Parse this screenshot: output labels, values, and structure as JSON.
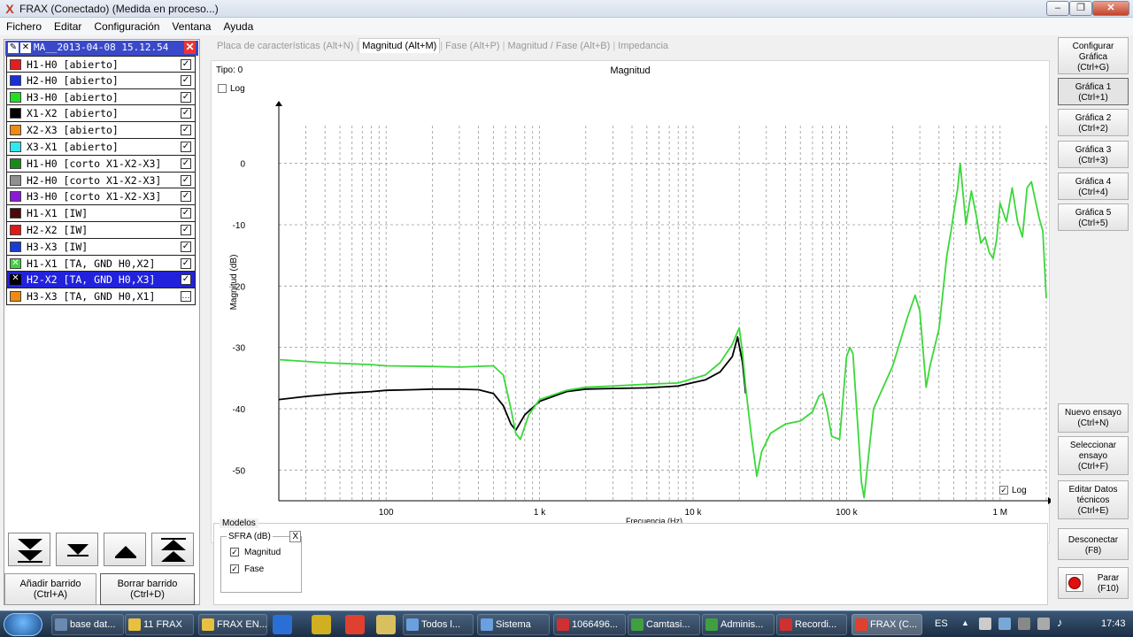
{
  "window": {
    "title": "FRAX (Conectado) (Medida en proceso...)",
    "app_icon": "X",
    "min_label": "–",
    "max_label": "❐",
    "close_label": "✕"
  },
  "menu": [
    "Fichero",
    "Editar",
    "Configuración",
    "Ventana",
    "Ayuda"
  ],
  "test": {
    "name": "MA__2013-04-08 15.12.54",
    "close_label": "✕"
  },
  "measurements": [
    {
      "label": "H1-H0 [abierto]",
      "color": "#e02020",
      "checked": true
    },
    {
      "label": "H2-H0 [abierto]",
      "color": "#1a2fd8",
      "checked": true
    },
    {
      "label": "H3-H0 [abierto]",
      "color": "#22e022",
      "checked": true
    },
    {
      "label": "X1-X2 [abierto]",
      "color": "#000000",
      "checked": true
    },
    {
      "label": "X2-X3 [abierto]",
      "color": "#f08a10",
      "checked": true
    },
    {
      "label": "X3-X1 [abierto]",
      "color": "#30e8f0",
      "checked": true
    },
    {
      "label": "H1-H0 [corto X1-X2-X3]",
      "color": "#1a8a1a",
      "checked": true
    },
    {
      "label": "H2-H0 [corto X1-X2-X3]",
      "color": "#909090",
      "checked": true
    },
    {
      "label": "H3-H0 [corto X1-X2-X3]",
      "color": "#8a1ad8",
      "checked": true
    },
    {
      "label": "H1-X1 [IW]",
      "color": "#4a0a0a",
      "checked": true
    },
    {
      "label": "H2-X2 [IW]",
      "color": "#e01818",
      "checked": true
    },
    {
      "label": "H3-X3 [IW]",
      "color": "#1a3ad8",
      "checked": true
    },
    {
      "label": "H1-X1 [TA, GND H0,X2]",
      "color": "#40d040",
      "checked": true
    },
    {
      "label": "H2-X2 [TA, GND H0,X3]",
      "color": "#000000",
      "checked": true,
      "selected": true
    },
    {
      "label": "H3-X3 [TA, GND H0,X1]",
      "color": "#f08a10",
      "checked": false
    }
  ],
  "left_buttons": {
    "add": "Añadir barrido\n(Ctrl+A)",
    "delete": "Borrar barrido\n(Ctrl+D)"
  },
  "tabs": [
    {
      "label": "Placa de características (Alt+N)",
      "active": false
    },
    {
      "label": "Magnitud (Alt+M)",
      "active": true
    },
    {
      "label": "Fase (Alt+P)",
      "active": false
    },
    {
      "label": "Magnitud / Fase (Alt+B)",
      "active": false
    },
    {
      "label": "Impedancia",
      "active": false
    }
  ],
  "chart_header": {
    "tipo": "Tipo: 0",
    "log_y_label": "Log",
    "log_x_label": "Log"
  },
  "chart_data": {
    "type": "line",
    "title": "Magnitud",
    "xlabel": "Frecuencia (Hz)",
    "ylabel": "Magnitud (dB)",
    "x_scale": "log",
    "xlim": [
      20,
      2000000
    ],
    "ylim": [
      -55,
      5
    ],
    "x_ticks": [
      {
        "value": 100,
        "label": "100"
      },
      {
        "value": 1000,
        "label": "1 k"
      },
      {
        "value": 10000,
        "label": "10 k"
      },
      {
        "value": 100000,
        "label": "100 k"
      },
      {
        "value": 1000000,
        "label": "1 M"
      }
    ],
    "y_ticks": [
      0,
      -10,
      -20,
      -30,
      -40,
      -50
    ],
    "grid": true,
    "series": [
      {
        "color": "#000000",
        "x": [
          20,
          30,
          50,
          80,
          100,
          150,
          200,
          300,
          400,
          500,
          580,
          650,
          700,
          800,
          1000,
          1500,
          2000,
          3000,
          5000,
          8000,
          12000,
          15000,
          18000,
          19500,
          21000,
          22000
        ],
        "y": [
          -38.5,
          -38.0,
          -37.5,
          -37.2,
          -37.0,
          -36.9,
          -36.8,
          -36.8,
          -36.9,
          -37.5,
          -39.5,
          -42.5,
          -43.5,
          -41.0,
          -38.8,
          -37.2,
          -36.8,
          -36.7,
          -36.6,
          -36.3,
          -35.3,
          -34.0,
          -31.5,
          -28.3,
          -32.5,
          -37.5
        ]
      },
      {
        "color": "#3ad83a",
        "x": [
          20,
          40,
          80,
          100,
          200,
          300,
          500,
          580,
          650,
          700,
          750,
          850,
          1000,
          1500,
          2000,
          3000,
          5000,
          8000,
          12000,
          15000,
          18000,
          20000,
          21000,
          22000,
          24000,
          26000,
          28000,
          32000,
          40000,
          50000,
          60000,
          66000,
          70000,
          75000,
          80000,
          90000,
          100000,
          105000,
          110000,
          120000,
          125000,
          130000,
          150000,
          200000,
          250000,
          280000,
          300000,
          330000,
          350000,
          400000,
          450000,
          480000,
          500000,
          530000,
          550000,
          600000,
          650000,
          700000,
          750000,
          800000,
          850000,
          900000,
          950000,
          1000000,
          1100000,
          1200000,
          1300000,
          1400000,
          1500000,
          1600000,
          1800000,
          1900000,
          2000000
        ],
        "y": [
          -32.0,
          -32.5,
          -32.8,
          -33.0,
          -33.1,
          -33.2,
          -33.0,
          -34.5,
          -40.0,
          -44.0,
          -45.0,
          -41.0,
          -38.5,
          -37.0,
          -36.5,
          -36.3,
          -36.0,
          -35.8,
          -34.5,
          -32.5,
          -29.5,
          -26.8,
          -31.0,
          -36.5,
          -44.5,
          -51.0,
          -47.0,
          -44.0,
          -42.5,
          -42.0,
          -40.5,
          -38.0,
          -37.5,
          -40.5,
          -44.5,
          -45.0,
          -31.5,
          -30.0,
          -31.0,
          -45.0,
          -52.0,
          -54.5,
          -40.0,
          -33.0,
          -25.0,
          -21.5,
          -24.0,
          -36.5,
          -33.0,
          -27.0,
          -15.0,
          -11.0,
          -8.0,
          -4.0,
          0.0,
          -10.0,
          -4.5,
          -8.5,
          -13.0,
          -12.0,
          -14.5,
          -15.5,
          -12.5,
          -6.5,
          -9.5,
          -4.0,
          -9.5,
          -12.0,
          -4.0,
          -3.0,
          -9.0,
          -11.0,
          -22.0
        ]
      }
    ]
  },
  "modelos": {
    "title": "Modelos",
    "group": "SFRA (dB)",
    "close_label": "X",
    "options": [
      {
        "label": "Magnitud",
        "checked": true
      },
      {
        "label": "Fase",
        "checked": true
      }
    ]
  },
  "right_buttons": {
    "configurar": "Configurar\nGráfica\n(Ctrl+G)",
    "graficas": [
      "Gráfica 1\n(Ctrl+1)",
      "Gráfica 2\n(Ctrl+2)",
      "Gráfica 3\n(Ctrl+3)",
      "Gráfica 4\n(Ctrl+4)",
      "Gráfica 5\n(Ctrl+5)"
    ],
    "nuevo": "Nuevo ensayo\n(Ctrl+N)",
    "seleccionar": "Seleccionar\nensayo\n(Ctrl+F)",
    "editar": "Editar Datos\ntécnicos\n(Ctrl+E)",
    "desconectar": "Desconectar\n(F8)",
    "parar": "Parar\n(F10)"
  },
  "taskbar": {
    "items": [
      {
        "label": "base dat...",
        "color": "#6a8ab0"
      },
      {
        "label": "11 FRAX",
        "color": "#e8c040"
      },
      {
        "label": "FRAX EN...",
        "color": "#e8c040"
      },
      {
        "label": "Todos l...",
        "color": "#6aa0e0"
      },
      {
        "label": "Sistema",
        "color": "#6aa0e0"
      },
      {
        "label": "1066496...",
        "color": "#d03030"
      },
      {
        "label": "Camtasi...",
        "color": "#40a040"
      },
      {
        "label": "Adminis...",
        "color": "#40a040"
      },
      {
        "label": "Recordi...",
        "color": "#d03030"
      },
      {
        "label": "FRAX (C...",
        "color": "#e04030"
      }
    ],
    "lang": "ES",
    "time": "17:43"
  }
}
